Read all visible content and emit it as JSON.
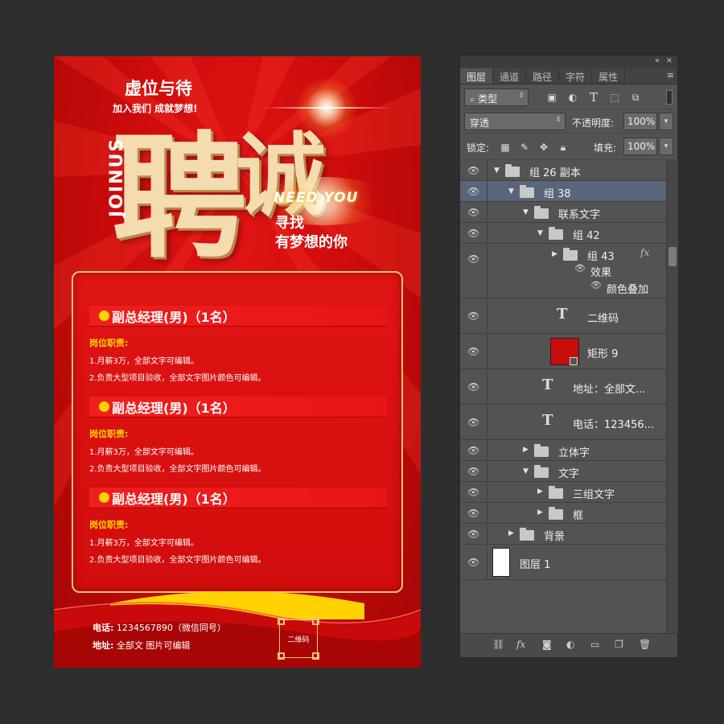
{
  "poster": {
    "top_line": "虚位与待",
    "sub_line": "加入我们 成就梦想!",
    "big_chars": [
      "聘",
      "诚"
    ],
    "vertical_text": "JOINUS",
    "need_you": "NEED YOU",
    "find_line1": "寻找",
    "find_line2": "有梦想的你",
    "jobs": [
      {
        "title": "副总经理(男)（1名）",
        "duty_label": "岗位职责:",
        "lines": [
          "1.月薪3万，全部文字可编辑。",
          "2.负责大型项目验收，全部文字图片颜色可编辑。"
        ]
      },
      {
        "title": "副总经理(男)（1名）",
        "duty_label": "岗位职责:",
        "lines": [
          "1.月薪3万，全部文字可编辑。",
          "2.负责大型项目验收，全部文字图片颜色可编辑。"
        ]
      },
      {
        "title": "副总经理(男)（1名）",
        "duty_label": "岗位职责:",
        "lines": [
          "1.月薪3万，全部文字可编辑。",
          "2.负责大型项目验收，全部文字图片颜色可编辑。"
        ]
      }
    ],
    "phone_label": "电话:",
    "phone_value": "1234567890（微信同号）",
    "address_label": "地址:",
    "address_value": "全部文 图片可编辑",
    "qr_label": "二维码",
    "colors": {
      "red": "#d20d0d",
      "gold": "#f2c27a",
      "yellow": "#ffd200"
    }
  },
  "panel": {
    "collapse_icon": "«",
    "close_icon": "×",
    "tabs": [
      "图层",
      "通道",
      "路径",
      "字符",
      "属性"
    ],
    "active_tab": "图层",
    "menu_icon": "≡",
    "filter_kind": "类型",
    "blend_mode": "穿透",
    "opacity_label": "不透明度:",
    "opacity_value": "100%",
    "lock_label": "锁定:",
    "fill_label": "填充:",
    "fill_value": "100%",
    "layers": [
      {
        "name": "组 26 副本",
        "type": "group",
        "expanded": true,
        "depth": 0,
        "selected": false
      },
      {
        "name": "组 38",
        "type": "group",
        "expanded": true,
        "depth": 1,
        "selected": true
      },
      {
        "name": "联系文字",
        "type": "group",
        "expanded": true,
        "depth": 2,
        "selected": false
      },
      {
        "name": "组 42",
        "type": "group",
        "expanded": true,
        "depth": 3,
        "selected": false
      },
      {
        "name": "组 43",
        "type": "group",
        "expanded": false,
        "depth": 4,
        "selected": false,
        "fx": true,
        "effects_label": "效果",
        "effect_item": "颜色叠加"
      },
      {
        "name": "二维码",
        "type": "text",
        "selected": false
      },
      {
        "name": "矩形 9",
        "type": "shape",
        "selected": false
      },
      {
        "name": "地址：全部文...",
        "type": "text",
        "selected": false
      },
      {
        "name": "电话：123456...",
        "type": "text",
        "selected": false
      },
      {
        "name": "立体字",
        "type": "group",
        "expanded": false,
        "depth": 2,
        "selected": false
      },
      {
        "name": "文字",
        "type": "group",
        "expanded": true,
        "depth": 2,
        "selected": false
      },
      {
        "name": "三组文字",
        "type": "group",
        "expanded": false,
        "depth": 3,
        "selected": false
      },
      {
        "name": "框",
        "type": "group",
        "expanded": false,
        "depth": 3,
        "selected": false
      },
      {
        "name": "背景",
        "type": "group",
        "expanded": false,
        "depth": 1,
        "selected": false
      },
      {
        "name": "图层 1",
        "type": "pixel",
        "selected": false
      }
    ],
    "fx_symbol": "fx"
  }
}
